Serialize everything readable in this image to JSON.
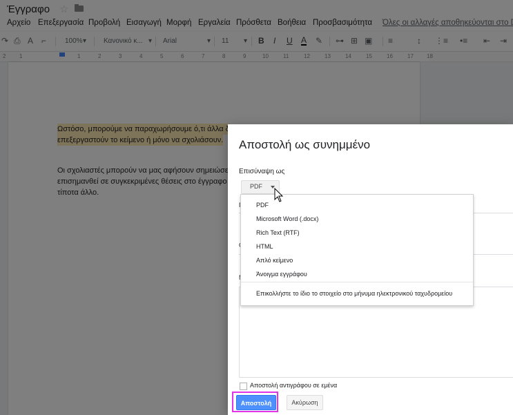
{
  "window": {
    "doc_title": "Έγγραφο"
  },
  "menubar": {
    "items": [
      "Αρχείο",
      "Επεξεργασία",
      "Προβολή",
      "Εισαγωγή",
      "Μορφή",
      "Εργαλεία",
      "Πρόσθετα",
      "Βοήθεια",
      "Προσβασιμότητα"
    ],
    "save_status": "Όλες οι αλλαγές αποθηκεύονται στο Drive"
  },
  "toolbar": {
    "zoom": "100%",
    "style": "Κανονικό κ...",
    "font": "Arial",
    "font_size": "11"
  },
  "ruler": {
    "ticks": [
      "2",
      "1",
      "1",
      "2",
      "3",
      "4",
      "5",
      "6",
      "7",
      "8",
      "9",
      "10",
      "11",
      "12",
      "13",
      "14",
      "15",
      "16",
      "17",
      "18"
    ]
  },
  "document": {
    "para1_line1": "Ωστόσο, μπορούμε να παραχωρήσουμε ό,τι άλλα δ",
    "para1_line2": "επεξεργαστούν το κείμενο ή μόνο να σχολιάσουν.",
    "para2_line1": "Οι σχολιαστές μπορούν να μας αφήσουν σημειώσε",
    "para2_line2": "επισημανθεί σε συγκεκριμένες θέσεις στο έγγραφο",
    "para2_line3": "τίποτα άλλο."
  },
  "dialog": {
    "title": "Αποστολή ως συνημμένο",
    "attach_label": "Επισύναψη ως",
    "format_value": "PDF",
    "field_letters": [
      "Π",
      "Θ",
      "Μ"
    ],
    "copy_label": "Αποστολή αντιγράφου σε εμένα",
    "send_label": "Αποστολή",
    "cancel_label": "Ακύρωση"
  },
  "format_menu": {
    "options": [
      "PDF",
      "Microsoft Word (.docx)",
      "Rich Text (RTF)",
      "HTML",
      "Απλό κείμενο",
      "Άνοιγμα εγγράφου"
    ],
    "paste_option": "Επικολλήστε το ίδιο το στοιχείο στο μήνυμα ηλεκτρονικού ταχυδρομείου"
  },
  "colors": {
    "send_button": "#4d90fe",
    "highlight_box": "#e233e8",
    "text_highlight": "#fce8b2"
  }
}
